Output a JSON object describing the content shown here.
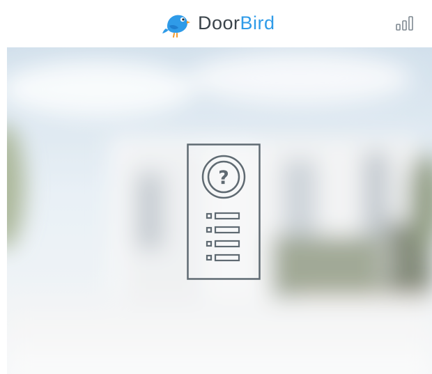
{
  "header": {
    "brand": {
      "logo_icon": "doorbird-bird-logo-icon",
      "text_primary": "Door",
      "text_accent": "Bird",
      "primary_color": "#3a434a",
      "accent_color": "#2f9be8"
    },
    "signal_icon": "signal-strength-icon"
  },
  "hero": {
    "background": "blurred-house-photo",
    "center_icon": "intercom-unknown-device-icon"
  }
}
